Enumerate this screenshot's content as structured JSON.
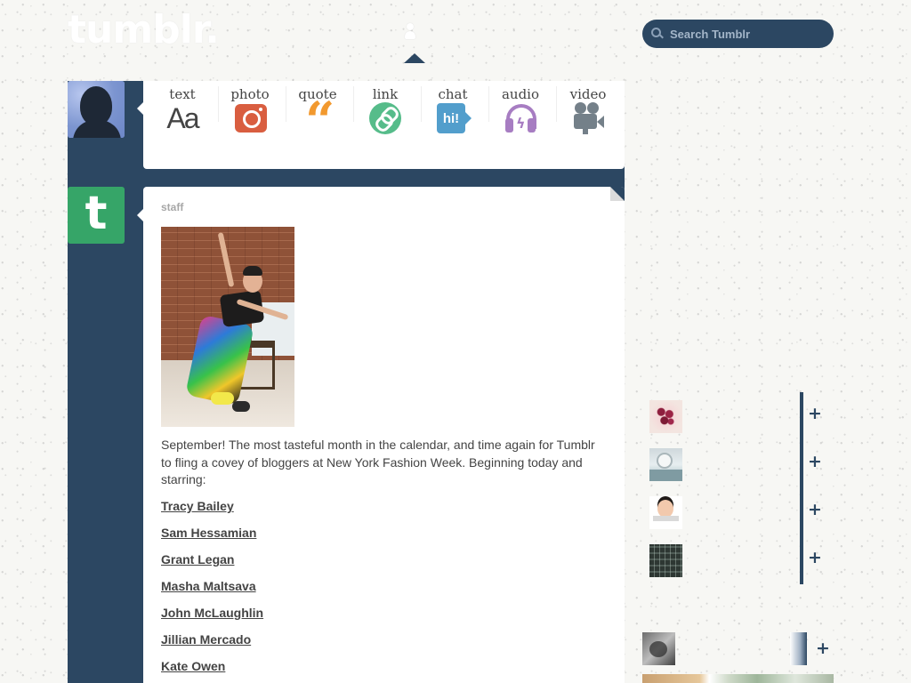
{
  "header": {
    "logo": "tumblr.",
    "account_icon": "person-icon"
  },
  "search": {
    "placeholder": "Search Tumblr",
    "icon": "search-icon"
  },
  "composer": {
    "avatar_icon": "silhouette-avatar",
    "post_types": [
      {
        "label": "text",
        "icon": "text-icon",
        "glyph": "Aa"
      },
      {
        "label": "photo",
        "icon": "camera-icon"
      },
      {
        "label": "quote",
        "icon": "quote-icon",
        "glyph": "“"
      },
      {
        "label": "link",
        "icon": "link-icon"
      },
      {
        "label": "chat",
        "icon": "chat-icon",
        "glyph": "hi!"
      },
      {
        "label": "audio",
        "icon": "headphones-icon"
      },
      {
        "label": "video",
        "icon": "video-camera-icon"
      }
    ]
  },
  "post": {
    "avatar_letter": "t",
    "author": "staff",
    "body": "September! The most tasteful month in the calendar, and time again for Tumblr to fling a covey of bloggers at New York Fashion Week. Beginning today and starring:",
    "links": [
      "Tracy Bailey",
      "Sam Hessamian",
      "Grant Legan",
      "Masha Maltsava",
      "John McLaughlin",
      "Jillian Mercado",
      "Kate Owen"
    ]
  },
  "sidebar": {
    "recommended": [
      {
        "thumb": "nail-art-thumbnail",
        "action": "+"
      },
      {
        "thumb": "winter-landscape-thumbnail",
        "action": "+"
      },
      {
        "thumb": "girl-portrait-thumbnail",
        "action": "+"
      },
      {
        "thumb": "dark-pattern-thumbnail",
        "action": "+"
      }
    ],
    "radar": {
      "thumb": "bw-photo-thumbnail",
      "action": "+"
    }
  },
  "colors": {
    "navy": "#2c4762",
    "page_bg": "#f7f7f4",
    "photo_icon": "#d95e40",
    "quote_icon": "#f2992e",
    "link_icon": "#56bc8a",
    "chat_icon": "#529ecc",
    "audio_icon": "#a77dc2",
    "video_icon": "#748089",
    "staff_avatar": "#36a568"
  }
}
